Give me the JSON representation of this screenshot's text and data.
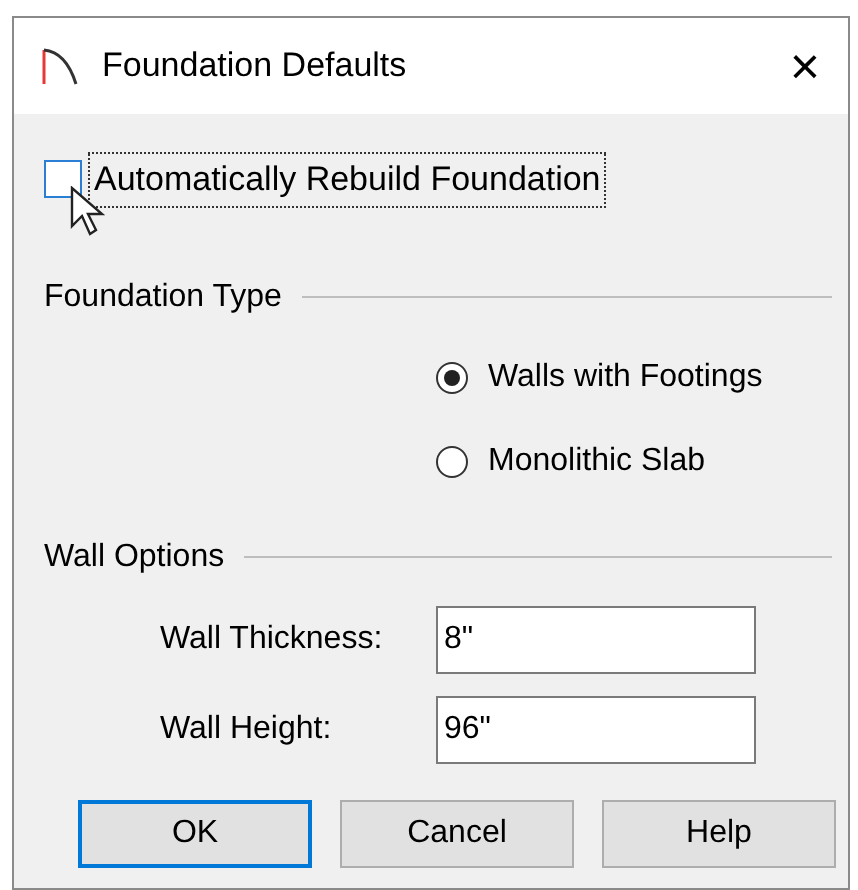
{
  "window": {
    "title": "Foundation Defaults",
    "close": "×"
  },
  "auto_rebuild": {
    "label": "Automatically Rebuild Foundation",
    "checked": false,
    "focused": true
  },
  "foundation_type": {
    "title": "Foundation Type",
    "options": [
      {
        "label": "Walls with Footings",
        "selected": true
      },
      {
        "label": "Monolithic Slab",
        "selected": false
      }
    ]
  },
  "wall_options": {
    "title": "Wall Options",
    "fields": [
      {
        "label": "Wall Thickness:",
        "value": "8\""
      },
      {
        "label": "Wall Height:",
        "value": "96\""
      }
    ]
  },
  "buttons": [
    {
      "label": "OK",
      "default": true
    },
    {
      "label": "Cancel",
      "default": false
    },
    {
      "label": "Help",
      "default": false
    }
  ]
}
